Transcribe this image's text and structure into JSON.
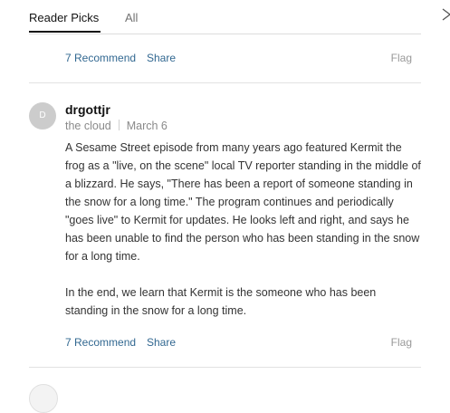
{
  "tabs": [
    {
      "label": "Reader Picks",
      "active": true
    },
    {
      "label": "All",
      "active": false
    }
  ],
  "previous_comment": {
    "recommend_label": "7 Recommend",
    "share_label": "Share",
    "flag_label": "Flag"
  },
  "comment": {
    "avatar_initial": "D",
    "username": "drgottjr",
    "location": "the cloud",
    "date": "March 6",
    "paragraphs": [
      "A Sesame Street episode from many years ago featured Kermit the frog as a \"live, on the scene\" local TV reporter standing in the middle of a blizzard.  He says, \"There has been a report of someone standing in the snow for a long time.\"  The program continues and periodically \"goes live\" to Kermit for updates.  He looks left and right, and says he has been unable to find the person who has been standing in the snow for a long time.",
      "In the end, we learn that Kermit is the someone who has been standing in the snow for a long time."
    ],
    "recommend_label": "7 Recommend",
    "share_label": "Share",
    "flag_label": "Flag"
  },
  "colors": {
    "link": "#326891",
    "muted": "#999999",
    "active_tab_underline": "#121212"
  },
  "icons": {
    "close": "close-icon"
  }
}
